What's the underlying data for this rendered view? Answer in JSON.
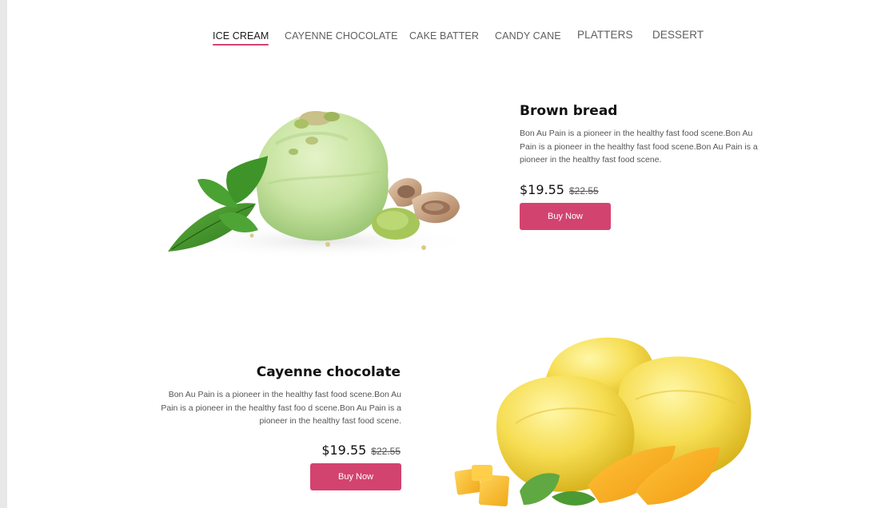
{
  "tabs": [
    {
      "label": "ICE CREAM",
      "active": true
    },
    {
      "label": "CAYENNE CHOCOLATE",
      "active": false
    },
    {
      "label": "CAKE BATTER",
      "active": false
    },
    {
      "label": "CANDY CANE",
      "active": false
    },
    {
      "label": "PLATTERS",
      "active": false
    },
    {
      "label": "DESSERT",
      "active": false
    }
  ],
  "products": [
    {
      "title": "Brown bread",
      "description": "Bon Au Pain is a pioneer in the healthy fast food scene.Bon Au Pain is a pioneer in the healthy fast food scene.Bon Au Pain is a pioneer in the healthy fast food scene.",
      "price": "$19.55",
      "old_price": "$22.55",
      "button_label": "Buy Now",
      "image": "pistachio-ice-cream-scoop"
    },
    {
      "title": "Cayenne chocolate",
      "description": "Bon Au Pain is a pioneer in the healthy fast food scene.Bon Au Pain is a pioneer in the healthy fast foo d scene.Bon Au Pain is a pioneer in the healthy fast food scene.",
      "price": "$19.55",
      "old_price": "$22.55",
      "button_label": "Buy Now",
      "image": "mango-sorbet-scoops"
    }
  ],
  "colors": {
    "accent": "#d3436f",
    "text_dark": "#111111",
    "text_muted": "#555555",
    "tab_inactive": "#5f5f5f"
  }
}
